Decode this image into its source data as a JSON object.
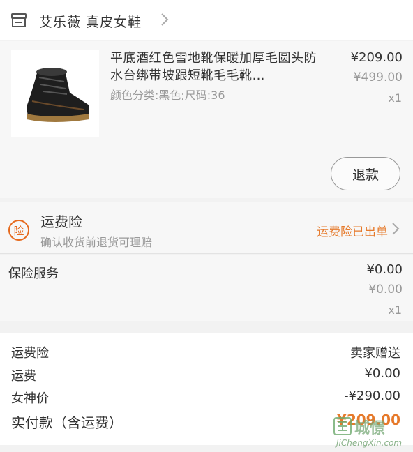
{
  "store": {
    "name": "艾乐薇  真皮女鞋"
  },
  "item": {
    "title": "平底酒红色雪地靴保暖加厚毛圆头防水台绑带坡跟短靴毛毛靴…",
    "spec": "颜色分类:黑色;尺码:36",
    "price_now": "¥209.00",
    "price_orig": "¥499.00",
    "qty": "x1",
    "refund_label": "退款"
  },
  "insurance": {
    "badge": "险",
    "title": "运费险",
    "subtitle": "确认收货前退货可理赔",
    "status": "运费险已出单"
  },
  "service": {
    "label": "保险服务",
    "price_now": "¥0.00",
    "price_orig": "¥0.00",
    "qty": "x1"
  },
  "summary": {
    "rows": [
      {
        "label": "运费险",
        "value": "卖家赠送"
      },
      {
        "label": "运费",
        "value": "¥0.00"
      },
      {
        "label": "女神价",
        "value": "-¥290.00"
      }
    ],
    "total_label": "实付款（含运费）",
    "total_value": "¥209.00"
  },
  "watermark": {
    "cn": "城憬",
    "en": "JiChengXin.com"
  },
  "colors": {
    "accent": "#e6792a",
    "muted": "#999999",
    "background": "#f7f7f7"
  }
}
